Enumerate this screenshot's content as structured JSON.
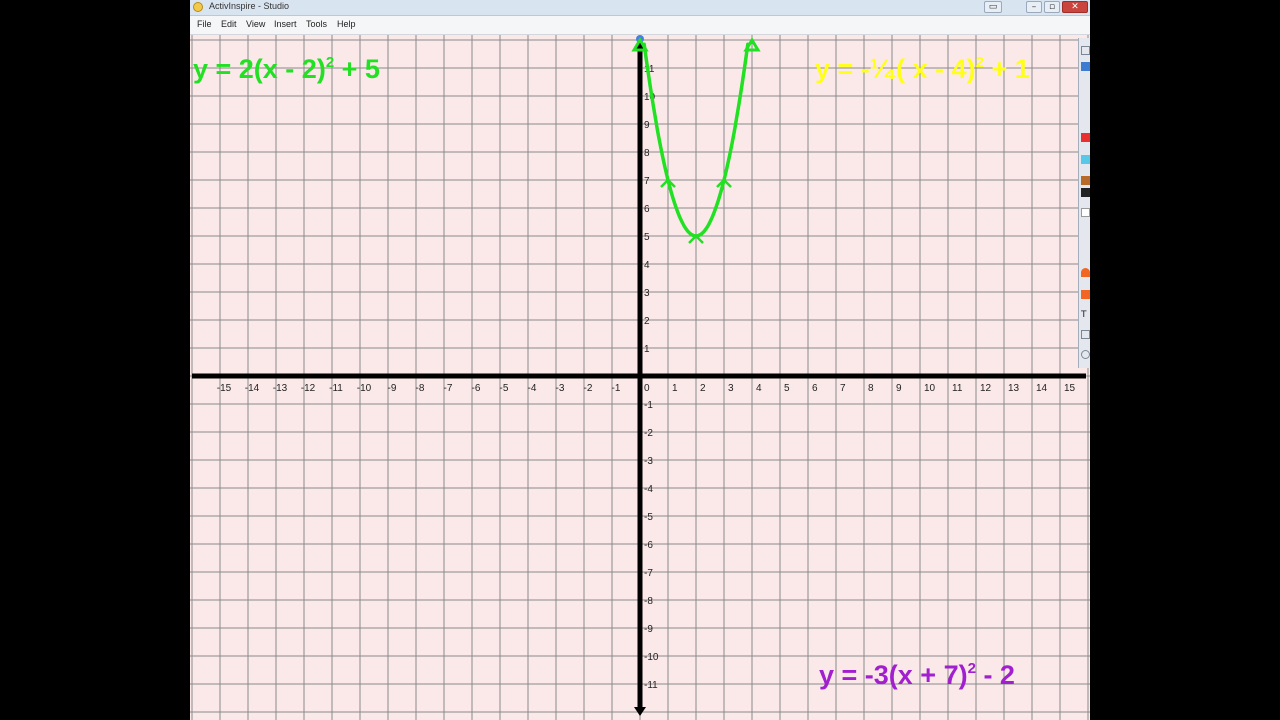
{
  "window": {
    "title": "ActivInspire - Studio"
  },
  "menu": [
    "File",
    "Edit",
    "View",
    "Insert",
    "Tools",
    "Help"
  ],
  "equations": {
    "green": {
      "pre": "y = 2(x - 2)",
      "exp": "2",
      "post": " + 5"
    },
    "yellow": {
      "pre": "y = -¹⁄₄( x - 4)",
      "exp": "2",
      "post": " + 1"
    },
    "purple": {
      "pre": "y = -3(x + 7)",
      "exp": "2",
      "post": " - 2"
    }
  },
  "graph": {
    "x_ticks": [
      "-15",
      "-14",
      "-13",
      "-12",
      "-11",
      "-10",
      "-9",
      "-8",
      "-7",
      "-6",
      "-5",
      "-4",
      "-3",
      "-2",
      "-1",
      "0",
      "1",
      "2",
      "3",
      "4",
      "5",
      "6",
      "7",
      "8",
      "9",
      "10",
      "11",
      "12",
      "13",
      "14",
      "15"
    ],
    "y_ticks_positive": [
      "1",
      "2",
      "3",
      "4",
      "5",
      "6",
      "7",
      "8",
      "9",
      "10",
      "11"
    ],
    "y_ticks_negative": [
      "-1",
      "-2",
      "-3",
      "-4",
      "-5",
      "-6",
      "-7",
      "-8",
      "-9",
      "-10",
      "-11"
    ],
    "parabola": {
      "vertex": [
        2,
        5
      ],
      "points": [
        [
          0,
          13
        ],
        [
          1,
          7
        ],
        [
          2,
          5
        ],
        [
          3,
          7
        ],
        [
          4,
          13
        ]
      ],
      "color": "#22e022"
    },
    "colors": {
      "grid": "#8a8a8a",
      "axis": "#000000",
      "background": "#fbe9e9",
      "label": "#222222"
    }
  },
  "toolbox_colors": [
    "#e83030",
    "#58c8e8",
    "#b86a2a",
    "#222222",
    "#f26522"
  ]
}
